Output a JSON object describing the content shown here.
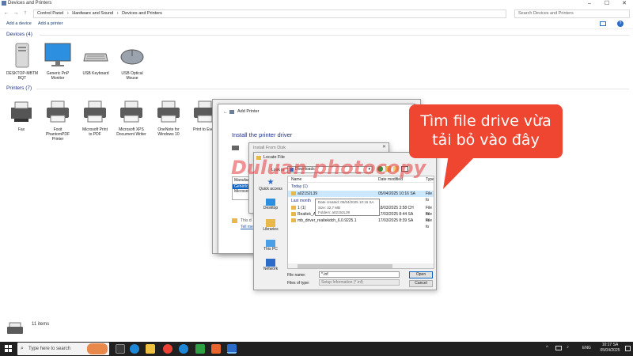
{
  "window": {
    "title": "Devices and Printers",
    "controls": [
      "–",
      "☐",
      "✕"
    ]
  },
  "address": {
    "crumbs": [
      "Control Panel",
      "›",
      "Hardware and Sound",
      "›",
      "Devices and Printers"
    ],
    "search_placeholder": "Search Devices and Printers"
  },
  "toolbar": {
    "add_device": "Add a device",
    "add_printer": "Add a printer"
  },
  "devices_section": {
    "heading": "Devices (4)",
    "items": [
      {
        "label": "DESKTOP-MBTM\nBQT",
        "icon": "pc-tower-icon"
      },
      {
        "label": "Generic PnP\nMonitor",
        "icon": "monitor-icon"
      },
      {
        "label": "USB Keyboard",
        "icon": "keyboard-icon"
      },
      {
        "label": "USB Optical\nMouse",
        "icon": "mouse-icon"
      }
    ]
  },
  "printers_section": {
    "heading": "Printers (7)",
    "items": [
      {
        "label": "Fax",
        "icon": "fax-icon"
      },
      {
        "label": "Foxit\nPhantomPDF\nPrinter",
        "icon": "printer-icon"
      },
      {
        "label": "Microsoft Print\nto PDF",
        "icon": "printer-icon"
      },
      {
        "label": "Microsoft XPS\nDocument Writer",
        "icon": "printer-icon"
      },
      {
        "label": "OneNote for\nWindows 10",
        "icon": "printer-icon"
      },
      {
        "label": "Print to Eve...",
        "icon": "printer-icon"
      }
    ]
  },
  "status": {
    "count": "11 items"
  },
  "add_printer_dialog": {
    "title": "Add Printer",
    "heading": "Install the printer driver",
    "list_header": "Manufac",
    "items": [
      "Generic",
      "Microsoft"
    ],
    "footer_text": "This d",
    "link": "Tell me"
  },
  "install_from_disk": {
    "title": "Install From Disk"
  },
  "locate_file": {
    "title": "Locate File",
    "look_in_label": "Look in:",
    "look_in_value": "Downloads",
    "columns": {
      "name": "Name",
      "date": "Date modified",
      "type": "Type"
    },
    "groups": {
      "today": "Today (1)",
      "last_month": "Last month"
    },
    "rows": [
      {
        "name": "a02152L39",
        "date": "05/04/2025 10:16 SA",
        "type": "File fo",
        "selected": true
      },
      {
        "name": "1 (1)",
        "date": "18/03/2025 3:58 CH",
        "type": "File fo",
        "selected": false
      },
      {
        "name": "Realtek_Audio_Driver_6.0.9093.1_Windows_En",
        "date": "17/03/2025 8:44 SA",
        "type": "File fo",
        "selected": false
      },
      {
        "name": "mb_driver_realtekdch_6.0.9225.1",
        "date": "17/03/2025 8:39 SA",
        "type": "File fo",
        "selected": false
      }
    ],
    "tooltip": {
      "created": "Date created: 05/04/2025 10:16 SA",
      "size": "Size: 32,7 MB",
      "folders": "Folders: a02152L39"
    },
    "sidebar": [
      "Quick access",
      "Desktop",
      "Libraries",
      "This PC",
      "Network"
    ],
    "file_name_label": "File name:",
    "file_name_value": "*.inf",
    "file_type_label": "Files of type:",
    "file_type_value": "Setup Information (*.inf)",
    "open": "Open",
    "cancel": "Cancel"
  },
  "watermark": "Duluan photocopy",
  "callout": {
    "line1": "Tìm file drive vừa",
    "line2": "tải bỏ vào đây"
  },
  "taskbar": {
    "search_placeholder": "Type here to search",
    "time": "10:17 SA",
    "date": "05/04/2025",
    "lang": "ENG"
  },
  "colors": {
    "accent": "#1e3287",
    "callout": "#ee4630",
    "selection": "#cce8ff"
  }
}
